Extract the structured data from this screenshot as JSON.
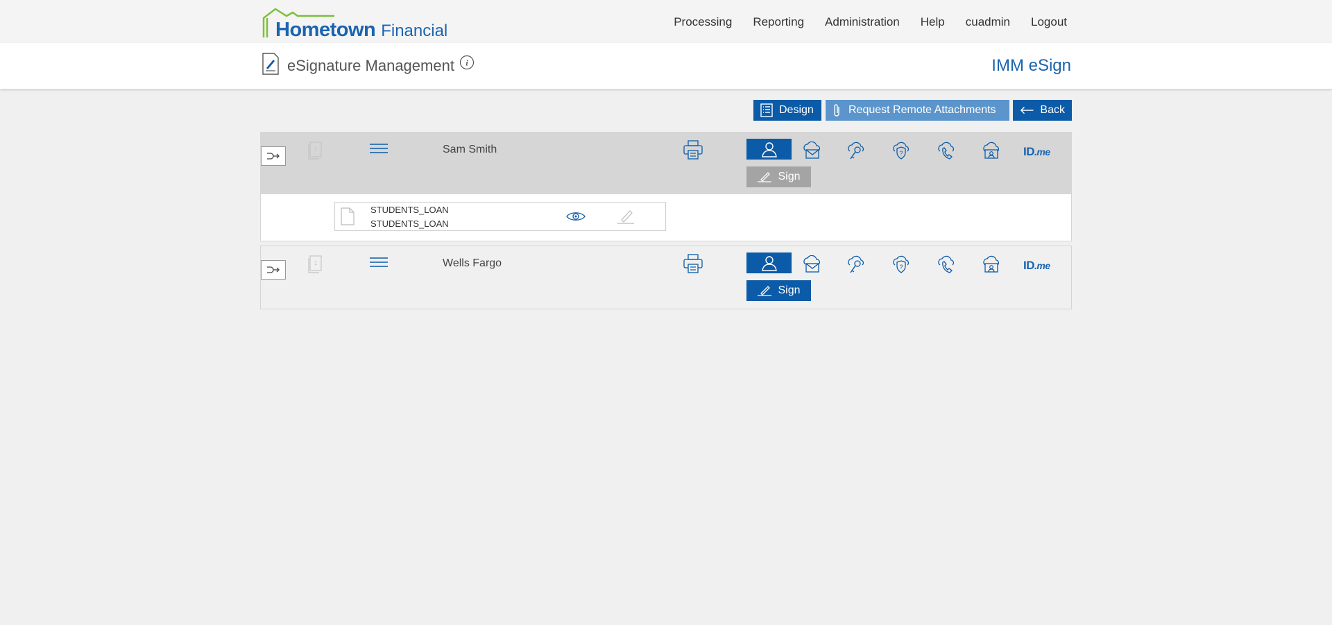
{
  "brand": {
    "main": "Hometown",
    "sub": "Financial",
    "house_color": "#7dbf3a",
    "text_color": "#1a64b0"
  },
  "nav": {
    "items": [
      "Processing",
      "Reporting",
      "Administration",
      "Help",
      "cuadmin",
      "Logout"
    ]
  },
  "header": {
    "title": "eSignature Management",
    "app_name": "IMM eSign",
    "info_icon": "info-icon"
  },
  "toolbar": {
    "design_label": "Design",
    "remote_label": "Request Remote Attachments",
    "back_label": "Back"
  },
  "signers": [
    {
      "name": "Sam Smith",
      "doc_count": "1",
      "sign_label": "Sign",
      "sign_enabled": false,
      "expanded": true,
      "auth_methods": [
        "in-person-icon",
        "email-cloud-icon",
        "password-key-icon",
        "kba-shield-icon",
        "phone-icon",
        "remote-id-icon",
        "idme-logo"
      ],
      "idme_label": {
        "main": "ID",
        "sub": ".me"
      },
      "documents": [
        {
          "title": "STUDENTS_LOAN",
          "subtitle": "STUDENTS_LOAN"
        }
      ]
    },
    {
      "name": "Wells Fargo",
      "doc_count": "1",
      "sign_label": "Sign",
      "sign_enabled": true,
      "expanded": false,
      "auth_methods": [
        "in-person-icon",
        "email-cloud-icon",
        "password-key-icon",
        "kba-shield-icon",
        "phone-icon",
        "remote-id-icon",
        "idme-logo"
      ],
      "idme_label": {
        "main": "ID",
        "sub": ".me"
      }
    }
  ],
  "colors": {
    "primary": "#0b5ba8",
    "secondary": "#5b95cc",
    "disabled": "#a4a4a4",
    "row_active": "#d6d6d6"
  }
}
